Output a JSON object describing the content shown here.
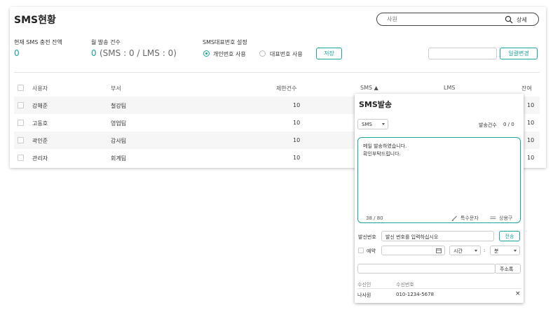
{
  "page": {
    "title": "SMS현황",
    "search": {
      "placeholder": "사원",
      "detail_label": "상세"
    }
  },
  "stats": {
    "balance_label": "현재 SMS 충전 잔액",
    "balance_value": "0",
    "monthly_label": "월 발송 건수",
    "monthly_count": "0",
    "monthly_detail": "(SMS : 0 / LMS : 0)",
    "rep_number_label": "SMS대표번호 설정",
    "option_personal": "개인번호 사용",
    "option_rep": "대표번호 사용",
    "option_selected": "personal",
    "save_label": "저장",
    "bulk_change_label": "일괄변경"
  },
  "table": {
    "headers": {
      "user": "사용자",
      "department": "부서",
      "limit": "제한건수",
      "sms": "SMS ▲",
      "lms": "LMS",
      "remaining": "잔여"
    },
    "rows": [
      {
        "user": "강해준",
        "department": "철강팀",
        "limit": "10",
        "remaining": "10"
      },
      {
        "user": "고동호",
        "department": "영업팀",
        "limit": "10",
        "remaining": "10"
      },
      {
        "user": "곽인준",
        "department": "감사팀",
        "limit": "10",
        "remaining": "10"
      },
      {
        "user": "관리자",
        "department": "회계팀",
        "limit": "10",
        "remaining": "10"
      }
    ]
  },
  "popup": {
    "title": "SMS발송",
    "type_value": "SMS",
    "send_count_label": "발송건수",
    "send_count_value": "0 / 0",
    "message": "메일 발송하였습니다.\n확인부탁드립니다.",
    "char_count": "38 / 80",
    "special_chars_label": "특수문자",
    "phrases_label": "상용구",
    "sender_label": "발신번호",
    "sender_placeholder": "발신 번호를 입력하십시오",
    "send_button": "전송",
    "reserve_label": "예약",
    "hour_label": "시간",
    "time_separator": ":",
    "minute_label": "분",
    "address_book_label": "주소록",
    "recipient_header_name": "수신인",
    "recipient_header_number": "수신번호",
    "recipients": [
      {
        "name": "나사원",
        "number": "010-1234-5678"
      }
    ],
    "remove_icon": "×"
  },
  "colors": {
    "accent": "#1ba5a0"
  }
}
